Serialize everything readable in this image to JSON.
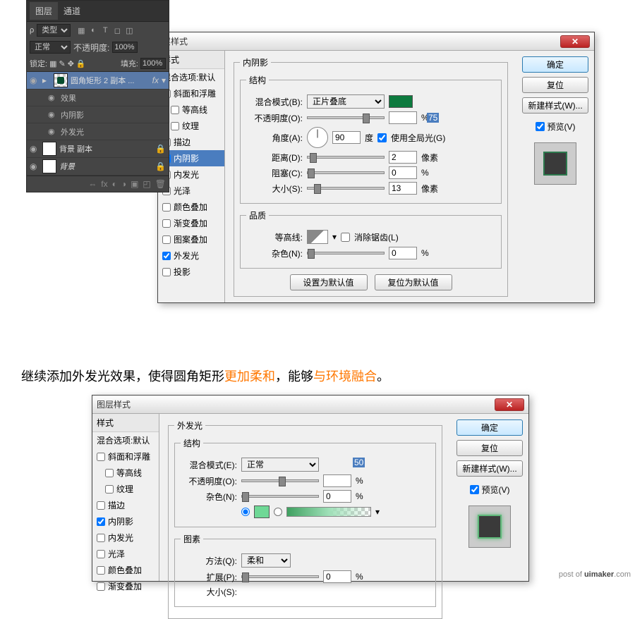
{
  "layers_panel": {
    "tab1": "图层",
    "tab2": "通道",
    "kind_label": "类型",
    "blend_mode": "正常",
    "opacity_label": "不透明度:",
    "opacity_value": "100%",
    "lock_label": "锁定:",
    "fill_label": "填充:",
    "fill_value": "100%",
    "layer1_name": "圆角矩形 2 副本 ...",
    "layer1_fx": "fx",
    "effects_label": "效果",
    "effect1": "内阴影",
    "effect2": "外发光",
    "layer2_name": "背景 副本",
    "layer3_name": "背景"
  },
  "dialog1": {
    "title": "层样式",
    "section_title": "内阴影",
    "structure_legend": "结构",
    "blend_label": "混合模式(B):",
    "blend_value": "正片叠底",
    "opacity_label": "不透明度(O):",
    "opacity_value": "75",
    "angle_label": "角度(A):",
    "angle_value": "90",
    "angle_unit": "度",
    "global_light": "使用全局光(G)",
    "distance_label": "距离(D):",
    "distance_value": "2",
    "distance_unit": "像素",
    "choke_label": "阻塞(C):",
    "choke_value": "0",
    "choke_unit": "%",
    "size_label": "大小(S):",
    "size_value": "13",
    "size_unit": "像素",
    "quality_legend": "品质",
    "contour_label": "等高线:",
    "antialias": "消除锯齿(L)",
    "noise_label": "杂色(N):",
    "noise_value": "0",
    "noise_unit": "%",
    "set_default": "设置为默认值",
    "reset_default": "复位为默认值"
  },
  "dialog2": {
    "title": "图层样式",
    "section_title": "外发光",
    "structure_legend": "结构",
    "blend_label": "混合模式(E):",
    "blend_value": "正常",
    "opacity_label": "不透明度(O):",
    "opacity_value": "50",
    "noise_label": "杂色(N):",
    "noise_value": "0",
    "noise_unit": "%",
    "elements_legend": "图素",
    "technique_label": "方法(Q):",
    "technique_value": "柔和",
    "spread_label": "扩展(P):",
    "spread_value": "0",
    "spread_unit": "%",
    "size_label": "大小(S):"
  },
  "style_list": {
    "header": "样式",
    "blend_options": "混合选项:默认",
    "bevel": "斜面和浮雕",
    "contour": "等高线",
    "texture": "纹理",
    "stroke": "描边",
    "inner_shadow": "内阴影",
    "inner_glow": "内发光",
    "satin": "光泽",
    "color_overlay": "颜色叠加",
    "gradient_overlay": "渐变叠加",
    "pattern_overlay": "图案叠加",
    "outer_glow": "外发光",
    "drop_shadow": "投影"
  },
  "buttons": {
    "ok": "确定",
    "cancel": "复位",
    "new_style": "新建样式(W)...",
    "preview": "预览(V)"
  },
  "caption": {
    "p1": "继续添加外发光效果，使得圆角矩形",
    "o1": "更加柔和",
    "p2": "，能够",
    "o2": "与环境融合",
    "p3": "。"
  },
  "watermark": {
    "pre": "post of ",
    "bold": "uimaker",
    "post": ".com"
  }
}
